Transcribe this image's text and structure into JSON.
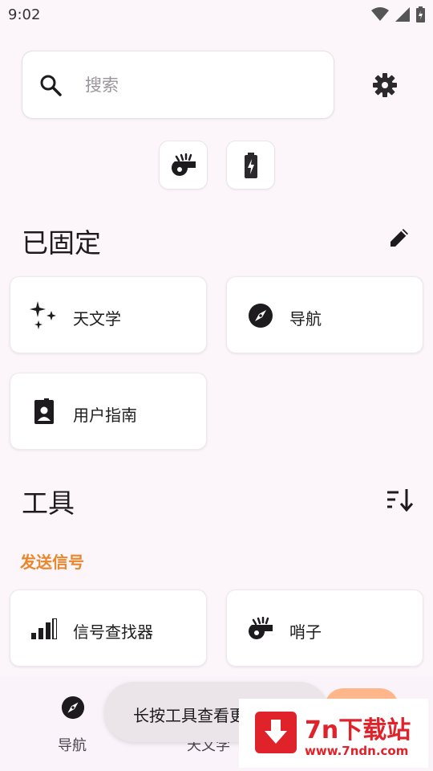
{
  "status_bar": {
    "time": "9:02"
  },
  "search": {
    "placeholder": "搜索",
    "value": ""
  },
  "pinned": {
    "title": "已固定",
    "items": [
      {
        "label": "天文学",
        "icon": "sparkle-icon"
      },
      {
        "label": "导航",
        "icon": "compass-icon"
      },
      {
        "label": "用户指南",
        "icon": "user-guide-icon"
      }
    ]
  },
  "tools": {
    "title": "工具",
    "category": "发送信号",
    "items": [
      {
        "label": "信号查找器",
        "icon": "signal-bars-icon"
      },
      {
        "label": "哨子",
        "icon": "whistle-icon"
      }
    ]
  },
  "bottom_nav": {
    "items": [
      {
        "label": "导航",
        "icon": "compass-icon"
      },
      {
        "label": "天文学",
        "icon": "sparkle-icon"
      }
    ]
  },
  "snackbar": {
    "text": "长按工具查看更"
  },
  "watermark": {
    "title": "7n下载站",
    "url": "www.7ndn.com"
  },
  "colors": {
    "accent": "#e8872b",
    "background": "#fcf6fb",
    "nav_pill": "#ffb68a",
    "watermark": "#e0222a"
  }
}
